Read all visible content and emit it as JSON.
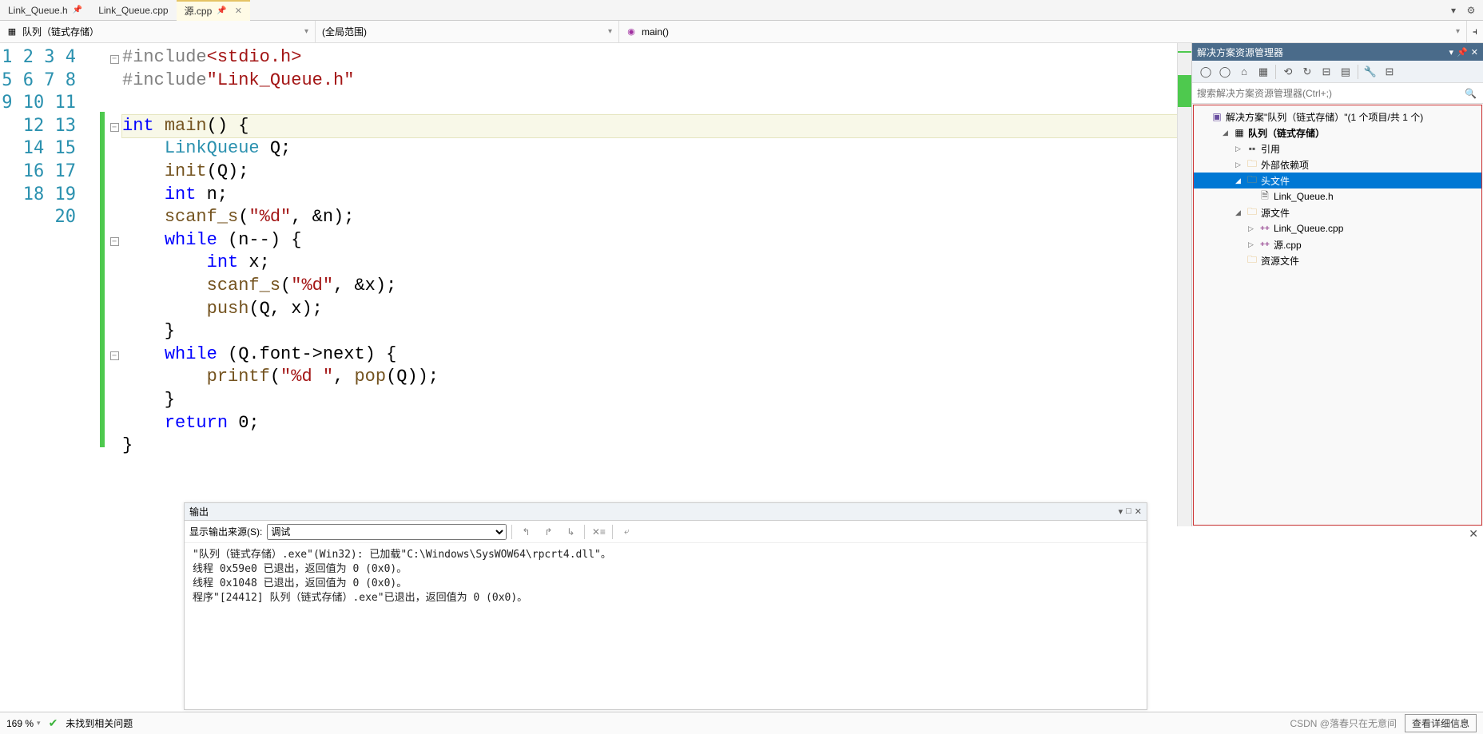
{
  "tabs": [
    {
      "label": "Link_Queue.h",
      "pinned": true,
      "active": false
    },
    {
      "label": "Link_Queue.cpp",
      "pinned": false,
      "active": false
    },
    {
      "label": "源.cpp",
      "pinned": true,
      "active": true
    }
  ],
  "scope": {
    "left": "队列（链式存储）",
    "middle": "(全局范围)",
    "right": "main()"
  },
  "code": {
    "lines": [
      "#include<stdio.h>",
      "#include\"Link_Queue.h\"",
      "",
      "int main() {",
      "    LinkQueue Q;",
      "    init(Q);",
      "    int n;",
      "    scanf_s(\"%d\", &n);",
      "    while (n--) {",
      "        int x;",
      "        scanf_s(\"%d\", &x);",
      "        push(Q, x);",
      "    }",
      "    while (Q.font->next) {",
      "        printf(\"%d \", pop(Q));",
      "    }",
      "    return 0;",
      "}",
      "",
      ""
    ],
    "line_count": 20,
    "highlighted_line": 4
  },
  "solution": {
    "panel_title": "解决方案资源管理器",
    "search_placeholder": "搜索解决方案资源管理器(Ctrl+;)",
    "root": "解决方案\"队列（链式存储）\"(1 个项目/共 1 个)",
    "project": "队列（链式存储）",
    "nodes": {
      "references": "引用",
      "external": "外部依赖项",
      "headers": "头文件",
      "header_file": "Link_Queue.h",
      "sources": "源文件",
      "source_file1": "Link_Queue.cpp",
      "source_file2": "源.cpp",
      "resources": "资源文件"
    }
  },
  "output": {
    "title": "输出",
    "source_label": "显示输出来源(S):",
    "source_value": "调试",
    "lines": [
      "\"队列（链式存储）.exe\"(Win32): 已加载\"C:\\Windows\\SysWOW64\\rpcrt4.dll\"。",
      "线程 0x59e0 已退出，返回值为 0 (0x0)。",
      "线程 0x1048 已退出，返回值为 0 (0x0)。",
      "程序\"[24412] 队列（链式存储）.exe\"已退出，返回值为 0 (0x0)。"
    ]
  },
  "status": {
    "zoom": "169 %",
    "issues": "未找到相关问题",
    "watermark": "CSDN @落春只在无意间",
    "detail_btn": "查看详细信息"
  }
}
